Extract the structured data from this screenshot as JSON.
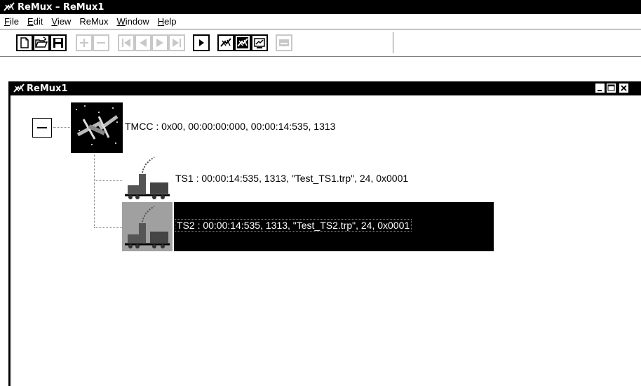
{
  "app": {
    "title": "ReMux – ReMux1"
  },
  "menu": {
    "items": [
      {
        "label": "File"
      },
      {
        "label": "Edit"
      },
      {
        "label": "View"
      },
      {
        "label": "ReMux"
      },
      {
        "label": "Window"
      },
      {
        "label": "Help"
      }
    ]
  },
  "toolbar": {
    "buttons": [
      {
        "icon": "new-document-icon",
        "enabled": true
      },
      {
        "icon": "open-folder-icon",
        "enabled": true
      },
      {
        "icon": "save-disk-icon",
        "enabled": true
      },
      {
        "icon": "add-plus-icon",
        "enabled": false
      },
      {
        "icon": "remove-minus-icon",
        "enabled": false
      },
      {
        "icon": "skip-first-icon",
        "enabled": false
      },
      {
        "icon": "step-back-icon",
        "enabled": false
      },
      {
        "icon": "step-forward-icon",
        "enabled": false
      },
      {
        "icon": "skip-last-icon",
        "enabled": false
      },
      {
        "icon": "play-icon",
        "enabled": true
      },
      {
        "icon": "remux-satellite-icon",
        "enabled": true
      },
      {
        "icon": "remux-satellite-alt-icon",
        "enabled": true
      },
      {
        "icon": "remux-view-icon",
        "enabled": true
      },
      {
        "icon": "output-device-icon",
        "enabled": false
      }
    ]
  },
  "document_window": {
    "title": "ReMux1",
    "controls": [
      "minimize",
      "maximize",
      "close"
    ]
  },
  "tree": {
    "root": {
      "label": "TMCC : 0x00, 00:00:00:000, 00:00:14:535, 1313",
      "icon": "satellite-icon",
      "expanded": true
    },
    "children": [
      {
        "label": "TS1 : 00:00:14:535, 1313, \"Test_TS1.trp\", 24, 0x0001",
        "icon": "transport-stream-icon",
        "selected": false
      },
      {
        "label": "TS2 : 00:00:14:535, 1313, \"Test_TS2.trp\", 24, 0x0001",
        "icon": "transport-stream-icon",
        "selected": true
      }
    ]
  },
  "colors": {
    "title_bar": "#000000",
    "selection": "#000000",
    "disabled": "#c8c8c8"
  }
}
